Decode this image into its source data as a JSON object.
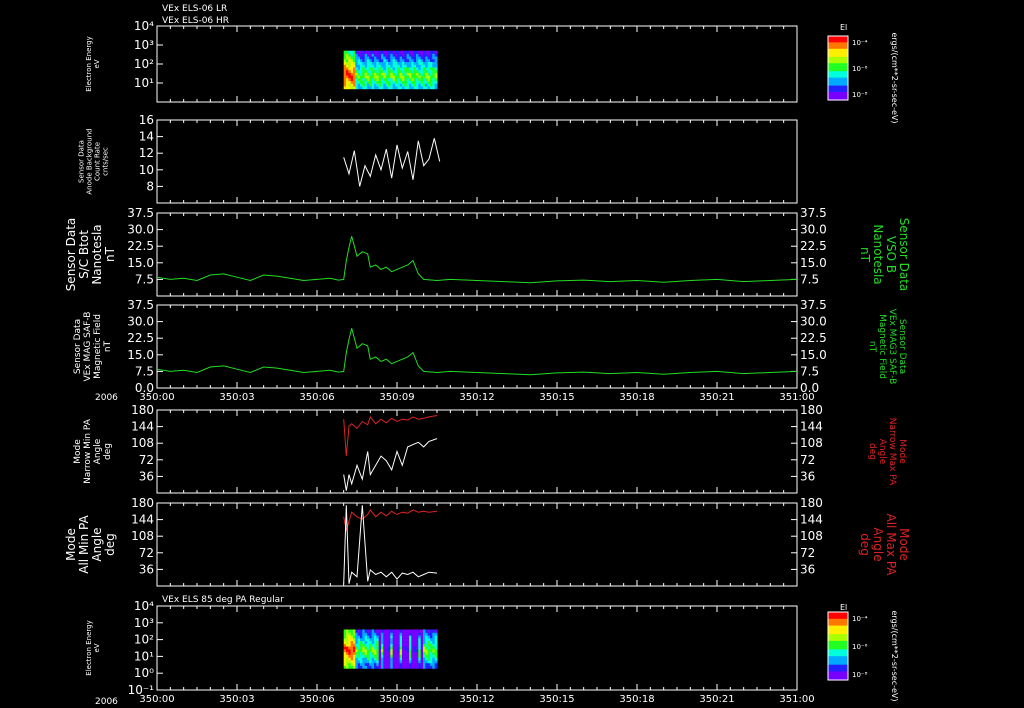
{
  "header": {
    "line1": "VEx ELS-06 LR",
    "line2": "VEx ELS-06 HR"
  },
  "year_label": "2006",
  "time_ticks": [
    "350:00",
    "350:03",
    "350:06",
    "350:09",
    "350:12",
    "350:15",
    "350:18",
    "350:21",
    "351:00"
  ],
  "colors": {
    "background": "#000000",
    "axis": "#ffffff",
    "green": "#22dd22",
    "red": "#dd2222",
    "white": "#ffffff",
    "spectrogram": [
      "#7700ff",
      "#2222ff",
      "#00aaff",
      "#00ffdd",
      "#22ff22",
      "#aaff00",
      "#ffee00",
      "#ff7700",
      "#ff0000"
    ]
  },
  "colorbar": {
    "title": "El",
    "unit": "ergs/(cm**2-sr-sec-eV)",
    "ticks": [
      "10⁻⁴",
      "10⁻⁶",
      "10⁻⁸"
    ]
  },
  "panel1": {
    "ylabel": [
      "Electron Energy",
      "eV"
    ],
    "yticks": [
      "10⁴",
      "10³",
      "10²",
      "10¹"
    ]
  },
  "panel2": {
    "ylabel": [
      "Sensor Data",
      "Anode Background",
      "Count Rate",
      "cnts/sec"
    ],
    "yticks": [
      "16",
      "14",
      "12",
      "10",
      "8"
    ]
  },
  "panel3": {
    "ylabel": [
      "Sensor Data",
      "S/C Btot",
      "Nanotesla",
      "nT"
    ],
    "rlabel": [
      "Sensor Data",
      "VSO B",
      "Nanotesla",
      "nT"
    ],
    "yticks": [
      "37.5",
      "30.0",
      "22.5",
      "15.0",
      "7.5"
    ]
  },
  "panel4": {
    "ylabel": [
      "Sensor Data",
      "VEx MAG SAF-B",
      "Magnetic Field",
      "nT"
    ],
    "rlabel": [
      "Sensor Data",
      "VEx MAG3 SAF-B",
      "Magnetic Field",
      "nT"
    ],
    "yticks": [
      "37.5",
      "30.0",
      "22.5",
      "15.0",
      "7.5",
      "0.0"
    ]
  },
  "panel5": {
    "ylabel": [
      "Mode",
      "Narrow Min PA",
      "Angle",
      "deg"
    ],
    "rlabel": [
      "Mode",
      "Narrow Max PA",
      "Angle",
      "deg"
    ],
    "yticks": [
      "180",
      "144",
      "108",
      "72",
      "36"
    ]
  },
  "panel6": {
    "ylabel": [
      "Mode",
      "All Min PA",
      "Angle",
      "deg"
    ],
    "rlabel": [
      "Mode",
      "All Max PA",
      "Angle",
      "deg"
    ],
    "yticks": [
      "180",
      "144",
      "108",
      "72",
      "36"
    ]
  },
  "panel7": {
    "title": "VEx ELS 85 deg PA Regular",
    "ylabel": [
      "Electron Energy",
      "eV"
    ],
    "yticks": [
      "10⁴",
      "10³",
      "10²",
      "10¹",
      "10⁰",
      "10⁻¹"
    ]
  },
  "chart_data": [
    {
      "type": "heatmap",
      "title": "VEx ELS-06 LR",
      "x_range": [
        "350:00",
        "351:00"
      ],
      "ylim_log10": [
        0,
        4
      ],
      "active_interval_minutes": [
        7.0,
        10.5
      ],
      "note_levels": "peak intensity near 10 to 100 eV around 350:07"
    },
    {
      "type": "line",
      "series": [
        {
          "x_minutes": [
            7.0,
            7.2,
            7.4,
            7.6,
            7.8,
            8.0,
            8.2,
            8.4,
            8.6,
            8.8,
            9.0,
            9.2,
            9.4,
            9.6,
            9.8,
            10.0,
            10.2,
            10.4,
            10.6
          ],
          "values": [
            11.5,
            9.5,
            12.3,
            8.0,
            10.5,
            9.2,
            11.8,
            10.0,
            12.5,
            9.0,
            13.0,
            10.2,
            12.2,
            8.8,
            13.5,
            10.5,
            11.3,
            13.8,
            11.0
          ]
        }
      ],
      "ylim": [
        6,
        16
      ]
    },
    {
      "type": "line",
      "series": [
        {
          "x_minutes": [
            0,
            0.5,
            1.0,
            1.5,
            2.0,
            2.5,
            3.0,
            3.5,
            4.0,
            4.5,
            5.0,
            5.5,
            6.0,
            6.5,
            6.8,
            7.0,
            7.1,
            7.2,
            7.3,
            7.5,
            7.7,
            7.9,
            8.0,
            8.2,
            8.4,
            8.6,
            8.8,
            9.0,
            9.2,
            9.4,
            9.6,
            9.8,
            10.0,
            10.5,
            11,
            12,
            13,
            14,
            15,
            16,
            17,
            18,
            19,
            20,
            21,
            22,
            23,
            24
          ],
          "values": [
            8.5,
            7.5,
            8.0,
            7.0,
            9.5,
            10.0,
            8.5,
            7.0,
            9.5,
            9.0,
            8.0,
            7.0,
            7.5,
            8.0,
            7.2,
            7.5,
            16,
            22,
            27,
            18,
            20,
            19,
            13,
            14,
            12,
            13,
            11,
            12,
            13,
            14,
            16,
            10,
            7.5,
            7.0,
            7.5,
            7.0,
            6.5,
            6.0,
            6.8,
            7.2,
            6.5,
            7.0,
            6.2,
            7.0,
            7.5,
            6.5,
            7.0,
            7.5
          ]
        }
      ],
      "ylim": [
        0,
        37.5
      ]
    },
    {
      "type": "line",
      "series": [
        {
          "x_minutes": [
            0,
            0.5,
            1.0,
            1.5,
            2.0,
            2.5,
            3.0,
            3.5,
            4.0,
            4.5,
            5.0,
            5.5,
            6.0,
            6.5,
            6.8,
            7.0,
            7.1,
            7.2,
            7.3,
            7.5,
            7.7,
            7.9,
            8.0,
            8.2,
            8.4,
            8.6,
            8.8,
            9.0,
            9.2,
            9.4,
            9.6,
            9.8,
            10.0,
            10.5,
            11,
            12,
            13,
            14,
            15,
            16,
            17,
            18,
            19,
            20,
            21,
            22,
            23,
            24
          ],
          "values": [
            8.5,
            7.5,
            8.0,
            7.0,
            9.5,
            10.0,
            8.5,
            7.0,
            9.5,
            9.0,
            8.0,
            7.0,
            7.5,
            8.0,
            7.2,
            7.5,
            16,
            22,
            27,
            18,
            20,
            19,
            13,
            14,
            12,
            13,
            11,
            12,
            13,
            14,
            16,
            10,
            7.5,
            7.0,
            7.5,
            7.0,
            6.5,
            6.0,
            6.8,
            7.2,
            6.5,
            7.0,
            6.2,
            7.0,
            7.5,
            6.5,
            7.0,
            7.5
          ]
        }
      ],
      "ylim": [
        0,
        37.5
      ]
    },
    {
      "type": "line",
      "series": [
        {
          "x_minutes": [
            7.0,
            7.1,
            7.2,
            7.3,
            7.5,
            7.7,
            7.9,
            8.0,
            8.2,
            8.4,
            8.6,
            8.8,
            9.0,
            9.2,
            9.4,
            9.6,
            9.8,
            10.0,
            10.2,
            10.5
          ],
          "values": [
            160,
            80,
            145,
            150,
            140,
            155,
            148,
            165,
            150,
            160,
            152,
            162,
            155,
            160,
            158,
            165,
            160,
            162,
            165,
            168
          ]
        },
        {
          "x_minutes": [
            7.0,
            7.1,
            7.2,
            7.3,
            7.5,
            7.7,
            7.9,
            8.0,
            8.2,
            8.4,
            8.6,
            8.8,
            9.0,
            9.2,
            9.4,
            9.6,
            9.8,
            10.0,
            10.2,
            10.5
          ],
          "values": [
            40,
            5,
            40,
            20,
            60,
            30,
            90,
            40,
            60,
            80,
            70,
            50,
            90,
            60,
            100,
            105,
            110,
            100,
            112,
            118
          ]
        }
      ],
      "ylim": [
        0,
        180
      ]
    },
    {
      "type": "line",
      "series": [
        {
          "x_minutes": [
            7.0,
            7.1,
            7.2,
            7.3,
            7.5,
            7.7,
            7.9,
            8.0,
            8.2,
            8.4,
            8.6,
            8.8,
            9.0,
            9.2,
            9.4,
            9.6,
            9.8,
            10.0,
            10.2,
            10.5
          ],
          "values": [
            150,
            120,
            140,
            160,
            150,
            145,
            155,
            165,
            150,
            160,
            152,
            162,
            155,
            160,
            158,
            165,
            160,
            162,
            160,
            162
          ]
        },
        {
          "x_minutes": [
            7.0,
            7.1,
            7.2,
            7.3,
            7.5,
            7.7,
            7.9,
            8.0,
            8.2,
            8.4,
            8.6,
            8.8,
            9.0,
            9.2,
            9.4,
            9.6,
            9.8,
            10.0,
            10.2,
            10.5
          ],
          "values": [
            5,
            175,
            5,
            30,
            20,
            175,
            10,
            35,
            25,
            30,
            20,
            30,
            15,
            28,
            25,
            30,
            20,
            25,
            30,
            28
          ]
        }
      ],
      "ylim": [
        0,
        180
      ]
    },
    {
      "type": "heatmap",
      "title": "VEx ELS 85 deg PA Regular",
      "x_range": [
        "350:00",
        "351:00"
      ],
      "ylim_log10": [
        -1,
        4
      ],
      "active_interval_minutes": [
        7.0,
        10.5
      ]
    }
  ]
}
